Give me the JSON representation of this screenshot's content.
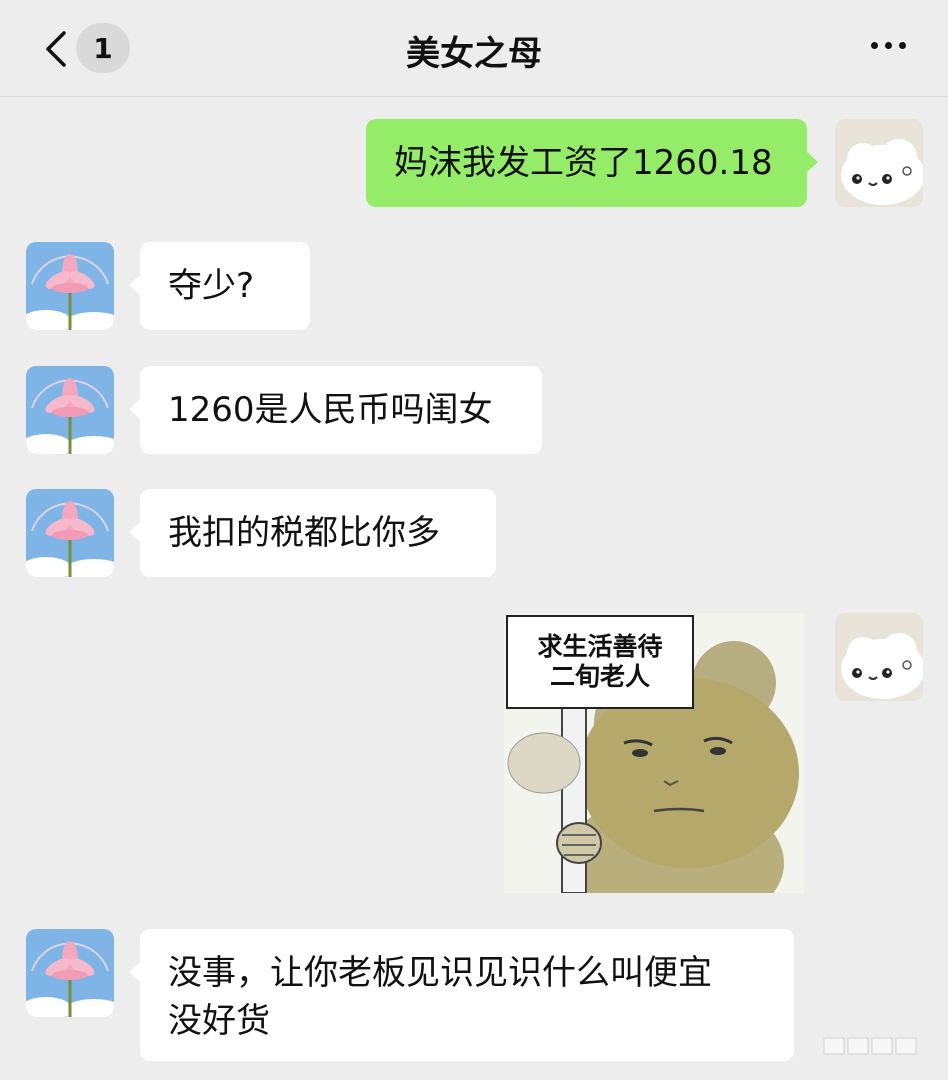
{
  "header": {
    "unread_count": "1",
    "title": "美女之母"
  },
  "messages": [
    {
      "side": "right",
      "text": "妈沫我发工资了1260.18"
    },
    {
      "side": "left",
      "text": "夺少?"
    },
    {
      "side": "left",
      "text": "1260是人民币吗闺女"
    },
    {
      "side": "left",
      "text": "我扣的税都比你多"
    },
    {
      "side": "right",
      "type": "sticker",
      "sign_line1": "求生活善待",
      "sign_line2": "二旬老人"
    },
    {
      "side": "left",
      "text": "没事，让你老板见识见识什么叫便宜\n没好货"
    }
  ],
  "colors": {
    "background": "#ededed",
    "sent_bubble": "#95ec69",
    "received_bubble": "#ffffff"
  },
  "icons": {
    "back": "chevron-left-icon",
    "more": "more-dots-icon",
    "self_avatar": "white-fluffy-creature-avatar",
    "contact_avatar": "lotus-sky-avatar"
  }
}
